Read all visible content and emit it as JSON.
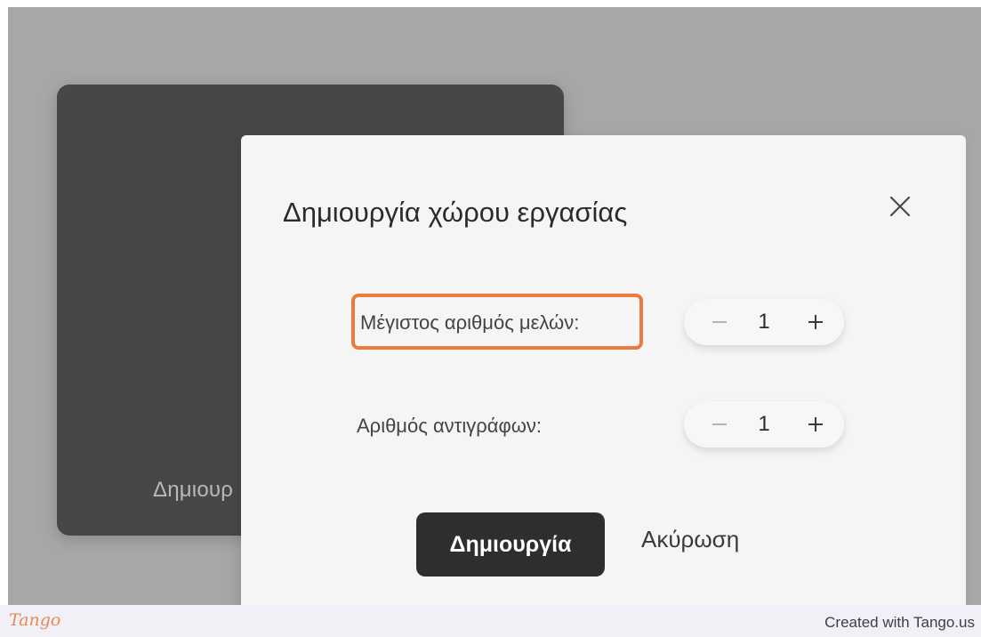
{
  "background_card": {
    "label": "Δημιουρ"
  },
  "dialog": {
    "title": "Δημιουργία χώρου εργασίας",
    "close_icon": "close-icon",
    "fields": [
      {
        "label": "Μέγιστος αριθμός μελών:",
        "value": "1",
        "highlighted": true
      },
      {
        "label": "Αριθμός αντιγράφων:",
        "value": "1",
        "highlighted": false
      }
    ],
    "stepper_icons": {
      "minus": "minus-icon",
      "plus": "plus-icon"
    },
    "primary_button": "Δημιουργία",
    "secondary_button": "Ακύρωση"
  },
  "highlight_color": "#ec7a3d",
  "footer": {
    "logo": "Tango",
    "credit": "Created with Tango.us"
  }
}
